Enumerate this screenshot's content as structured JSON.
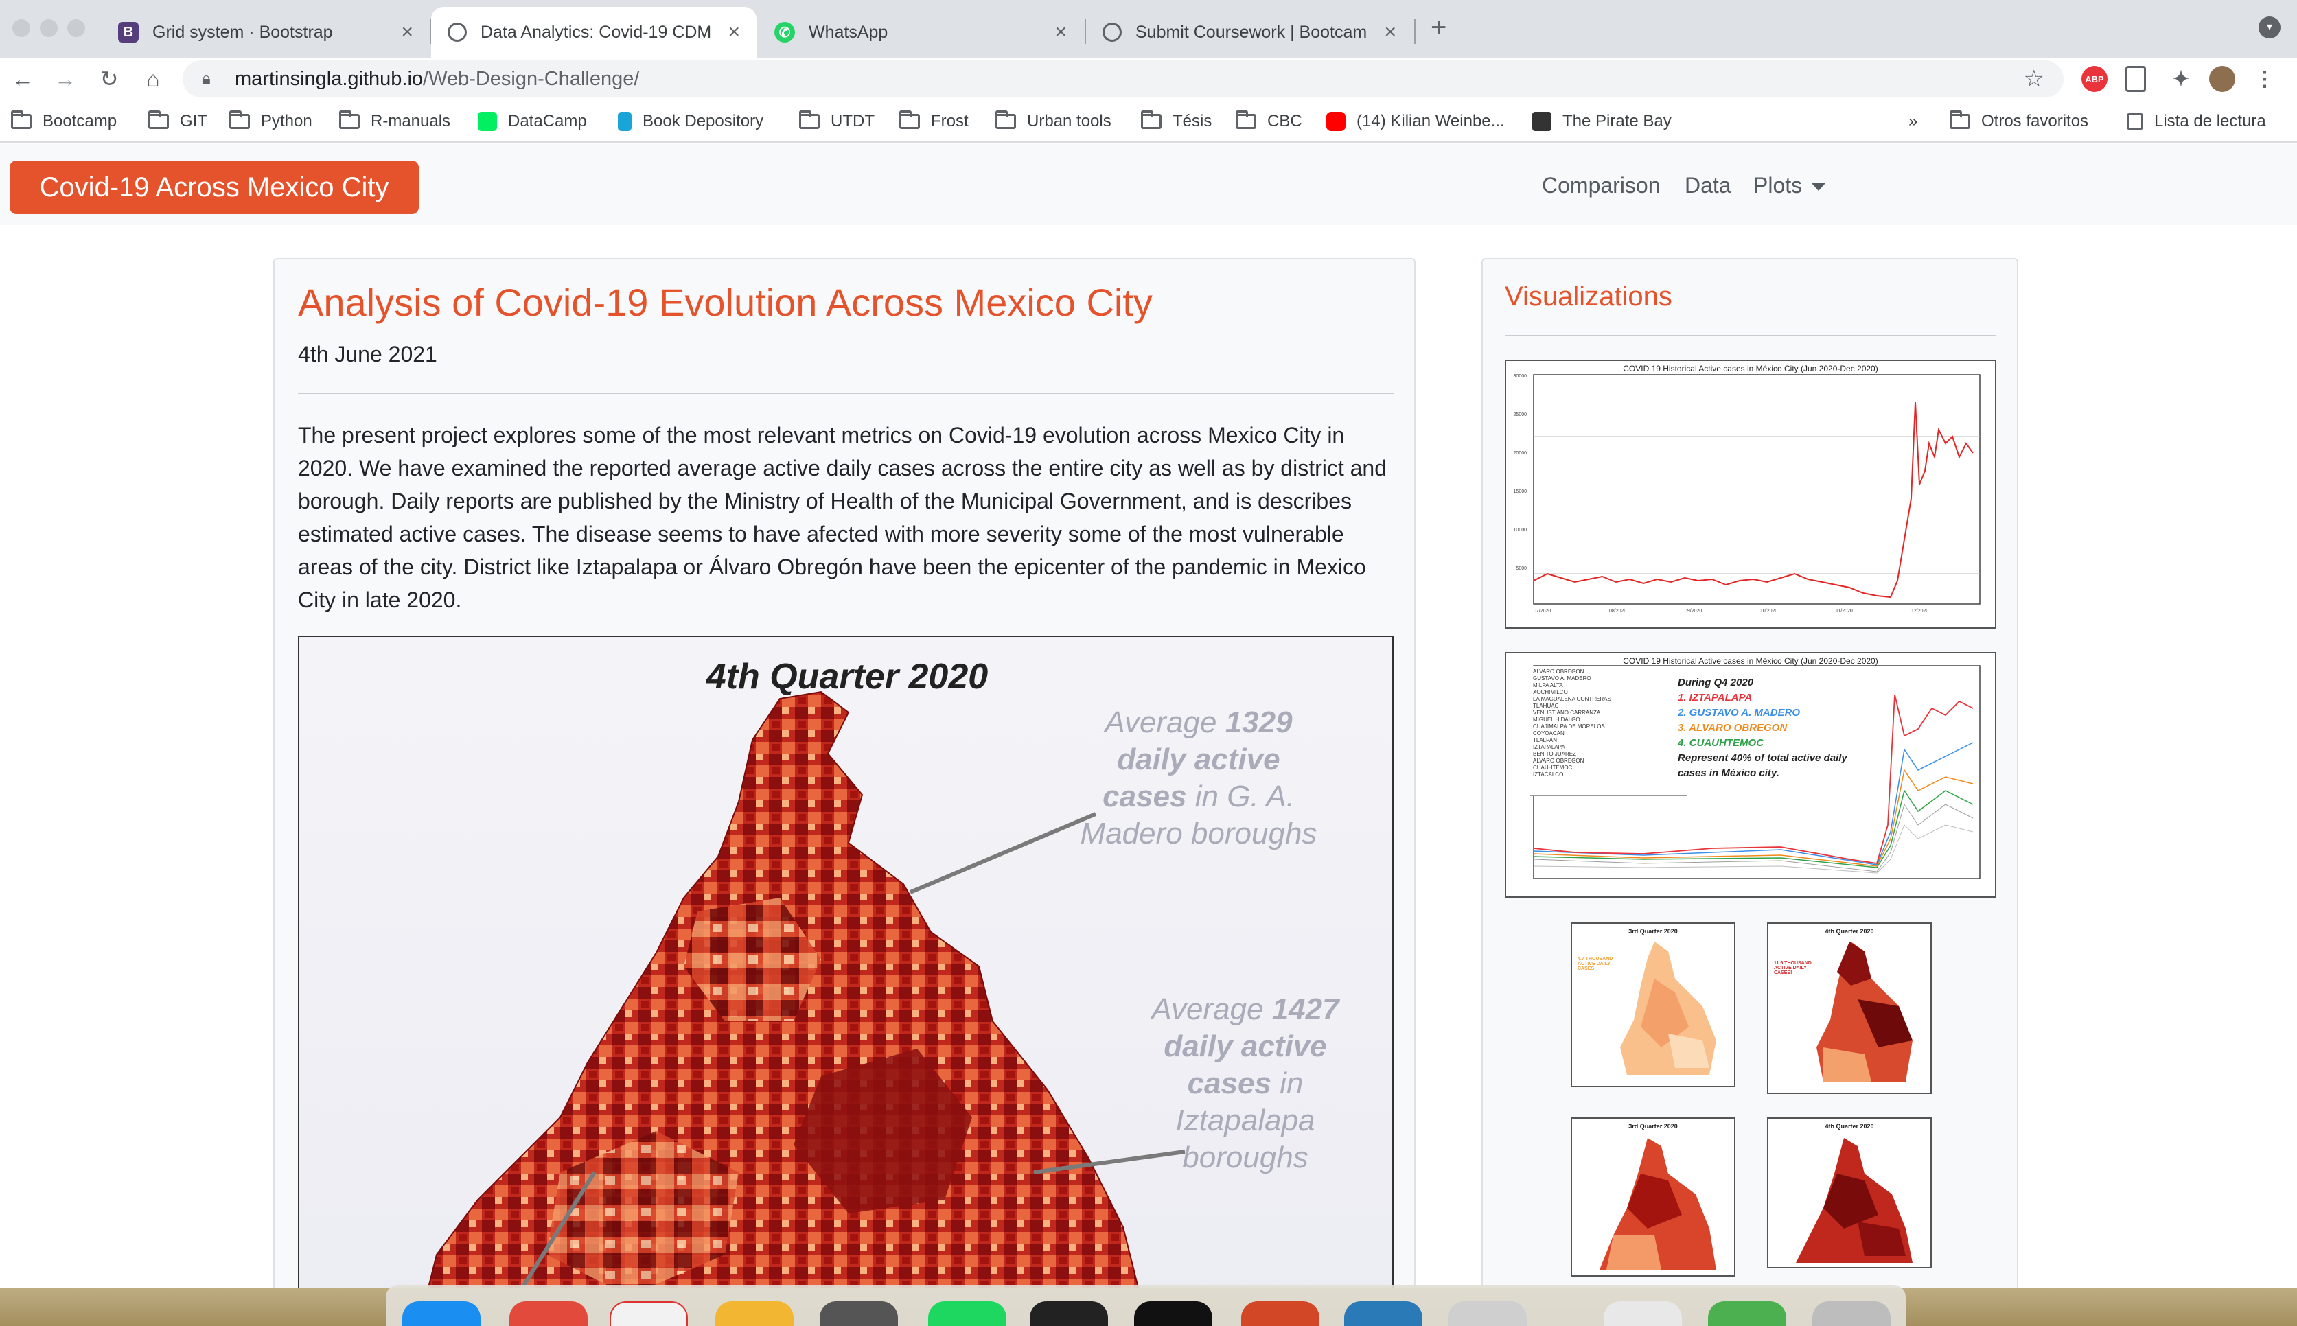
{
  "browser": {
    "tabs": [
      {
        "title": "Grid system · Bootstrap",
        "icon": "bootstrap-icon",
        "active": false
      },
      {
        "title": "Data Analytics: Covid-19 CDM",
        "icon": "globe-icon",
        "active": true
      },
      {
        "title": "WhatsApp",
        "icon": "whatsapp-icon",
        "active": false
      },
      {
        "title": "Submit Coursework | Bootcam",
        "icon": "globe-icon",
        "active": false
      }
    ],
    "new_tab": "+",
    "url_host": "martinsingla.github.io",
    "url_path": "/Web-Design-Challenge/",
    "bookmarks": [
      "Bootcamp",
      "GIT",
      "Python",
      "R-manuals",
      "DataCamp",
      "Book Depository",
      "UTDT",
      "Frost",
      "Urban tools",
      "Tésis",
      "CBC",
      "(14) Kilian Weinbe...",
      "The Pirate Bay"
    ],
    "bookmarks_overflow": "»",
    "other_bookmarks": "Otros favoritos",
    "reading_list": "Lista de lectura"
  },
  "navbar": {
    "brand": "Covid-19 Across Mexico City",
    "links": {
      "comparison": "Comparison",
      "data": "Data",
      "plots": "Plots"
    }
  },
  "article": {
    "title": "Analysis of Covid-19 Evolution Across Mexico City",
    "date": "4th June 2021",
    "body": "The present project explores some of the most relevant metrics on Covid-19 evolution across Mexico City in 2020. We have examined the reported average active daily cases across the entire city as well as by district and borough. Daily reports are published by the Ministry of Health of the Municipal Government, and is describes estimated active cases. The disease seems to have afected with more severity some of the most vulnerable areas of the city. District like Iztapalapa or Álvaro Obregón have been the epicenter of the pandemic in Mexico City in late 2020.",
    "map": {
      "title": "4th Quarter 2020",
      "annotation_1": {
        "pre": "Average ",
        "num": "1329",
        "bold": "daily active",
        "mid": "cases",
        "post": " in G. A.",
        "end": "Madero boroughs"
      },
      "annotation_2": {
        "pre": "Average ",
        "num": "1427",
        "bold": "daily active",
        "mid": "cases",
        "post": " in",
        "end1": "Iztapalapa",
        "end2": "boroughs"
      }
    }
  },
  "sidebar": {
    "title": "Visualizations",
    "plot1_title": "COVID 19 Historical Active cases in México City (Jun 2020-Dec 2020)",
    "plot2_title": "COVID 19 Historical Active cases in México City (Jun 2020-Dec 2020)",
    "plot2_note": [
      "During Q4 2020",
      "1. IZTAPALAPA",
      "2. GUSTAVO A. MADERO",
      "3. ALVARO OBREGON",
      "4. CUAUHTEMOC",
      "Represent 40% of total active daily",
      "cases in México city."
    ],
    "plot2_note_colors": [
      "#222222",
      "#e8343a",
      "#3b8ee8",
      "#f08a1c",
      "#2fa34a",
      "#222222",
      "#222222"
    ],
    "plot2_legend": [
      "ALVARO OBREGON",
      "GUSTAVO A. MADERO",
      "MILPA ALTA",
      "XOCHIMILCO",
      "LA MAGDALENA CONTRERAS",
      "TLAHUAC",
      "VENUSTIANO CARRANZA",
      "MIGUEL HIDALGO",
      "CUAJIMALPA DE MORELOS",
      "COYOACAN",
      "TLALPAN",
      "IZTAPALAPA",
      "BENITO JUAREZ",
      "ALVARO OBREGON",
      "CUAUHTEMOC",
      "IZTACALCO"
    ],
    "map_thumbs": [
      {
        "title": "3rd Quarter 2020",
        "note": "4.7 THOUSAND ACTIVE DAILY CASES"
      },
      {
        "title": "4th Quarter 2020",
        "note": "11.6 THOUSAND ACTIVE DAILY CASES!"
      },
      {
        "title": "3rd Quarter 2020",
        "note": ""
      },
      {
        "title": "4th Quarter 2020",
        "note": ""
      }
    ],
    "thumb_note_colors": [
      "#f2a33a",
      "#d32f2f"
    ]
  },
  "colors": {
    "accent": "#e5532d",
    "navbar_bg": "#f8f9fa",
    "card_bg": "#f8f9fa",
    "line": "#e32626"
  }
}
